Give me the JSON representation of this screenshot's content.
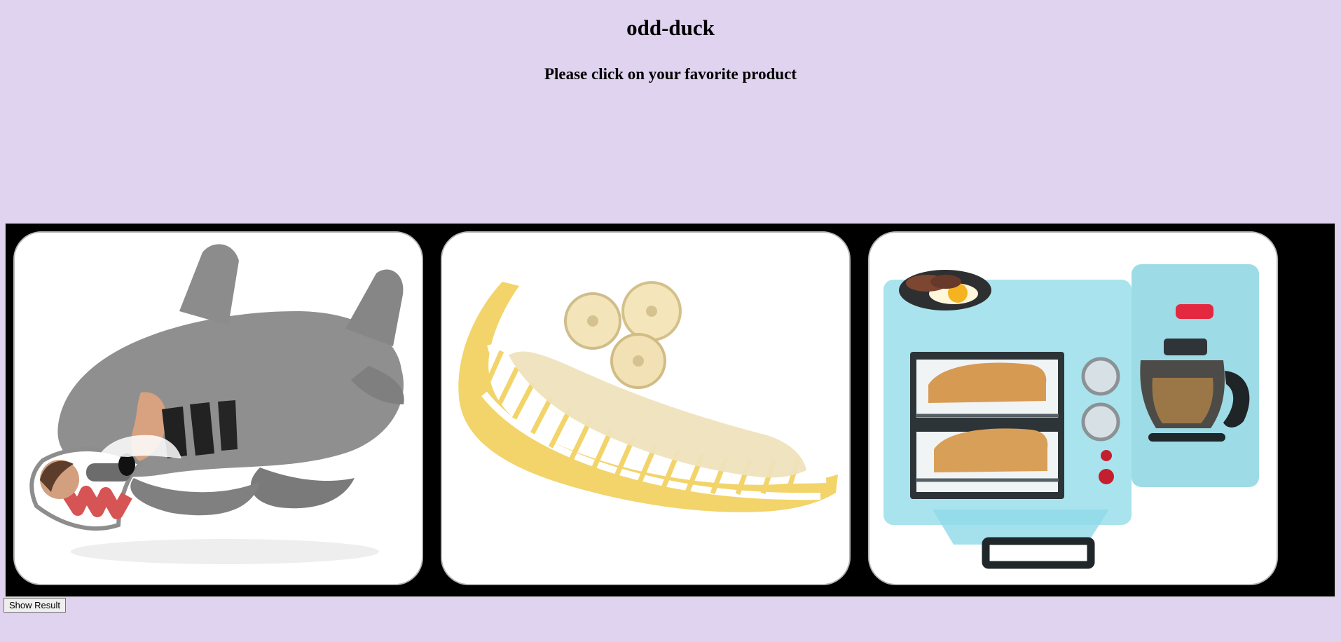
{
  "header": {
    "title": "odd-duck",
    "subtitle": "Please click on your favorite product"
  },
  "products": [
    {
      "name": "shark-sleeping-bag",
      "icon": "shark-sleeping-bag-image"
    },
    {
      "name": "banana-slicer",
      "icon": "banana-slicer-image"
    },
    {
      "name": "breakfast-maker",
      "icon": "breakfast-maker-image"
    }
  ],
  "actions": {
    "show_result_label": "Show Result"
  },
  "colors": {
    "background": "#dfd3ef",
    "stage": "#000000",
    "card": "#ffffff",
    "banana_slicer": "#f2d46a",
    "breakfast_maker": "#a9e4ee"
  }
}
